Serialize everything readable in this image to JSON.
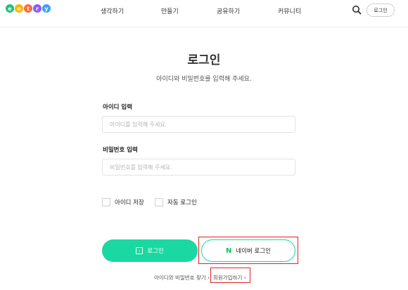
{
  "header": {
    "logo_letters": [
      {
        "char": "e",
        "color": "#1ec27a"
      },
      {
        "char": "n",
        "color": "#ffb400"
      },
      {
        "char": "t",
        "color": "#ff6a3d"
      },
      {
        "char": "r",
        "color": "#8a5cf6"
      },
      {
        "char": "y",
        "color": "#3aa0ff"
      }
    ],
    "nav": [
      "생각하기",
      "만들기",
      "공유하기",
      "커뮤니티"
    ],
    "login_label": "로그인"
  },
  "main": {
    "title": "로그인",
    "subtitle": "아이디와 비밀번호를 입력해 주세요.",
    "id_label": "아이디 입력",
    "id_placeholder": "아이디를 입력해 주세요.",
    "id_value": "",
    "pw_label": "비밀번호 입력",
    "pw_placeholder": "비밀번호를 입력해 주세요.",
    "pw_value": "",
    "save_id_label": "아이디 저장",
    "auto_login_label": "자동 로그인",
    "login_button": "로그인",
    "naver_login_button": "네이버 로그인",
    "naver_mark": "N",
    "find_link": "아이디와 비밀번호 찾기 ›",
    "signup_link": "회원가입하기 ›"
  },
  "colors": {
    "accent": "#19d8a1",
    "naver_green": "#03c75a",
    "highlight_frame": "#e02020"
  }
}
